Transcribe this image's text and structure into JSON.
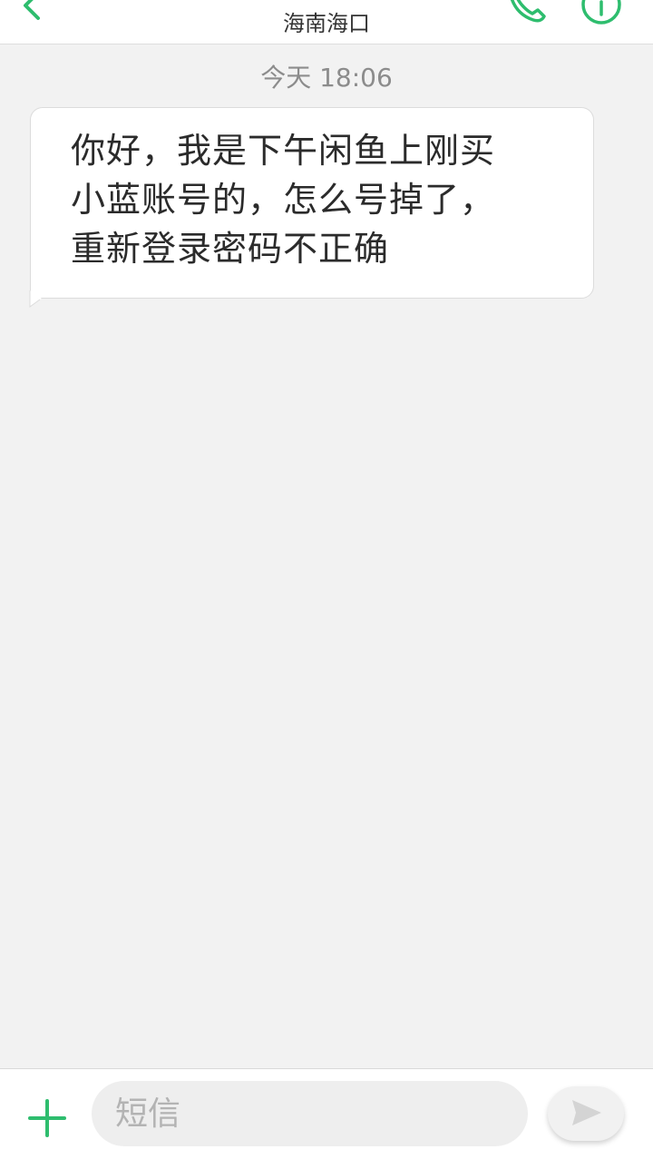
{
  "header": {
    "title": "海南海口"
  },
  "conversation": {
    "timestamp": "今天 18:06",
    "messages": [
      {
        "direction": "incoming",
        "lines": [
          "你好，我是下午闲鱼上刚买",
          "小蓝账号的，怎么号掉了，",
          "重新登录密码不正确"
        ]
      }
    ]
  },
  "composer": {
    "placeholder": "短信"
  },
  "icons": {
    "back": "chevron-left-icon",
    "call": "phone-icon",
    "info": "info-icon",
    "attach": "plus-icon",
    "send": "send-icon"
  },
  "colors": {
    "accent": "#2ebd6e",
    "background": "#f2f2f2",
    "bubble": "#ffffff"
  }
}
